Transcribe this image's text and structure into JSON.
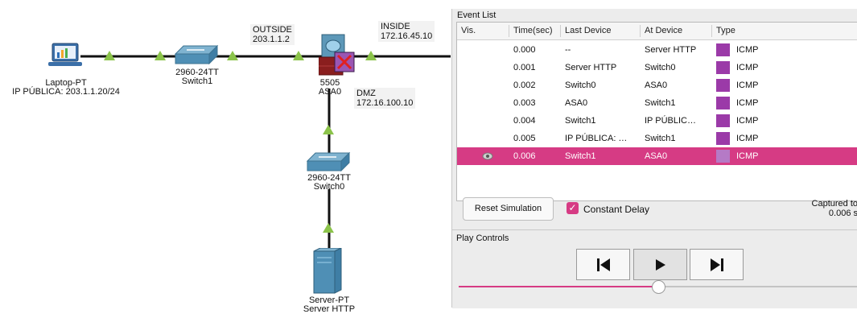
{
  "topology": {
    "laptop": {
      "name": "Laptop-PT",
      "ip": "IP PÚBLICA: 203.1.1.20/24"
    },
    "switch1": {
      "model": "2960-24TT",
      "name": "Switch1"
    },
    "asa": {
      "model": "5505",
      "name": "ASA0"
    },
    "switch0": {
      "model": "2960-24TT",
      "name": "Switch0"
    },
    "server": {
      "model": "Server-PT",
      "name": "Server HTTP"
    },
    "outside": {
      "label": "OUTSIDE",
      "ip": "203.1.1.2"
    },
    "inside": {
      "label": "INSIDE",
      "ip": "172.16.45.10"
    },
    "dmz": {
      "label": "DMZ",
      "ip": "172.16.100.10"
    }
  },
  "event_list": {
    "title": "Event List",
    "columns": [
      "Vis.",
      "Time(sec)",
      "Last Device",
      "At Device",
      "Type"
    ],
    "rows": [
      {
        "time": "0.000",
        "last": "--",
        "at": "Server HTTP",
        "type": "ICMP"
      },
      {
        "time": "0.001",
        "last": "Server HTTP",
        "at": "Switch0",
        "type": "ICMP"
      },
      {
        "time": "0.002",
        "last": "Switch0",
        "at": "ASA0",
        "type": "ICMP"
      },
      {
        "time": "0.003",
        "last": "ASA0",
        "at": "Switch1",
        "type": "ICMP"
      },
      {
        "time": "0.004",
        "last": "Switch1",
        "at": "IP PÚBLIC…",
        "type": "ICMP"
      },
      {
        "time": "0.005",
        "last": "IP PÚBLICA: …",
        "at": "Switch1",
        "type": "ICMP"
      },
      {
        "time": "0.006",
        "last": "Switch1",
        "at": "ASA0",
        "type": "ICMP",
        "selected": true
      }
    ],
    "type_color": "#9b3aa8",
    "selected_color": "#d63b84"
  },
  "controls": {
    "reset_label": "Reset Simulation",
    "constant_delay_label": "Constant Delay",
    "constant_delay_checked": true,
    "captured_line1": "Captured to",
    "captured_line2": "0.006 s"
  },
  "play": {
    "title": "Play Controls",
    "back_icon": "skip-back-icon",
    "play_icon": "play-icon",
    "forward_icon": "skip-forward-icon",
    "speed_fraction": 0.5
  }
}
